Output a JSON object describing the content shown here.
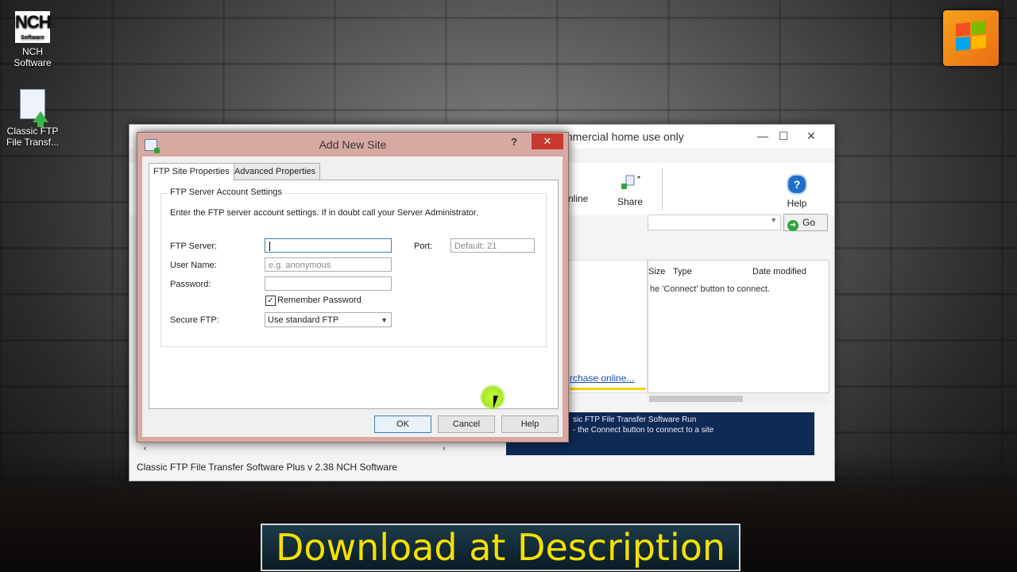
{
  "desktop": {
    "icons": [
      {
        "label_line1": "NCH",
        "label_line2": "Software",
        "logo_text": "NCH",
        "logo_sub": "Software"
      },
      {
        "label_line1": "Classic FTP",
        "label_line2": "File Transf..."
      }
    ]
  },
  "main_window": {
    "title": "mmercial home use only",
    "controls": {
      "minimize": "—",
      "maximize": "☐",
      "close": "✕"
    },
    "toolbar": [
      {
        "label": "nline"
      },
      {
        "label": "Share"
      },
      {
        "label": "Help"
      }
    ],
    "go_label": "Go",
    "columns": [
      "Size",
      "Type",
      "Date modified"
    ],
    "list_hint": "he 'Connect' button to connect.",
    "purchase_link": "rchase online...",
    "log_lines": [
      "sic FTP File Transfer Software Run",
      "- the Connect button to connect to a site"
    ],
    "status_text": "Classic FTP File Transfer Software Plus v 2.38  NCH Software"
  },
  "dialog": {
    "title": "Add New Site",
    "help_glyph": "?",
    "close_glyph": "✕",
    "tabs": [
      {
        "label": "FTP Site Properties",
        "active": true
      },
      {
        "label": "Advanced Properties",
        "active": false
      }
    ],
    "group_label": "FTP Server Account Settings",
    "instructions": "Enter the FTP server account settings. If in doubt call your Server Administrator.",
    "fields": {
      "ftp_server": {
        "label": "FTP Server:",
        "value": "",
        "placeholder": ""
      },
      "port": {
        "label": "Port:",
        "placeholder": "Default: 21"
      },
      "user_name": {
        "label": "User Name:",
        "placeholder": "e.g. anonymous"
      },
      "password": {
        "label": "Password:",
        "value": ""
      },
      "remember_password": {
        "label": "Remember Password",
        "checked": true
      },
      "secure_ftp": {
        "label": "Secure FTP:",
        "selected": "Use standard FTP"
      }
    },
    "buttons": {
      "ok": "OK",
      "cancel": "Cancel",
      "help": "Help"
    }
  },
  "banner": {
    "text": "Download at Description"
  },
  "colors": {
    "dialog_frame": "#d8a9a3",
    "close_red": "#c7392e",
    "banner_text": "#f4e000",
    "log_bg": "#0e2a55"
  }
}
